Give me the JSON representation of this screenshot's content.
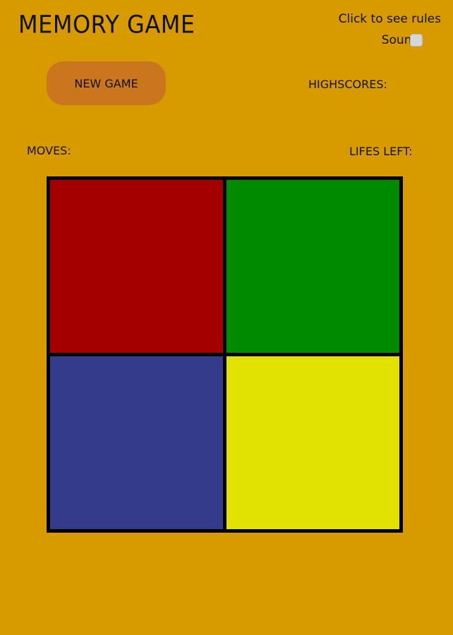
{
  "header": {
    "title": "MEMORY GAME",
    "rules_link": "Click to see rules",
    "sound_label": "Sound:"
  },
  "controls": {
    "new_game_label": "NEW GAME",
    "highscores_label": "HIGHSCORES:"
  },
  "stats": {
    "moves_label": "MOVES:",
    "lifes_label": "LIFES LEFT:"
  },
  "colors": {
    "background": "#d79b00",
    "button": "#c9761d",
    "tiles": [
      "#a50000",
      "#008a00",
      "#333b8a",
      "#e2e200"
    ]
  },
  "board": {
    "tiles": [
      {
        "name": "red",
        "color": "#a50000"
      },
      {
        "name": "green",
        "color": "#008a00"
      },
      {
        "name": "blue",
        "color": "#333b8a"
      },
      {
        "name": "yellow",
        "color": "#e2e200"
      }
    ]
  }
}
